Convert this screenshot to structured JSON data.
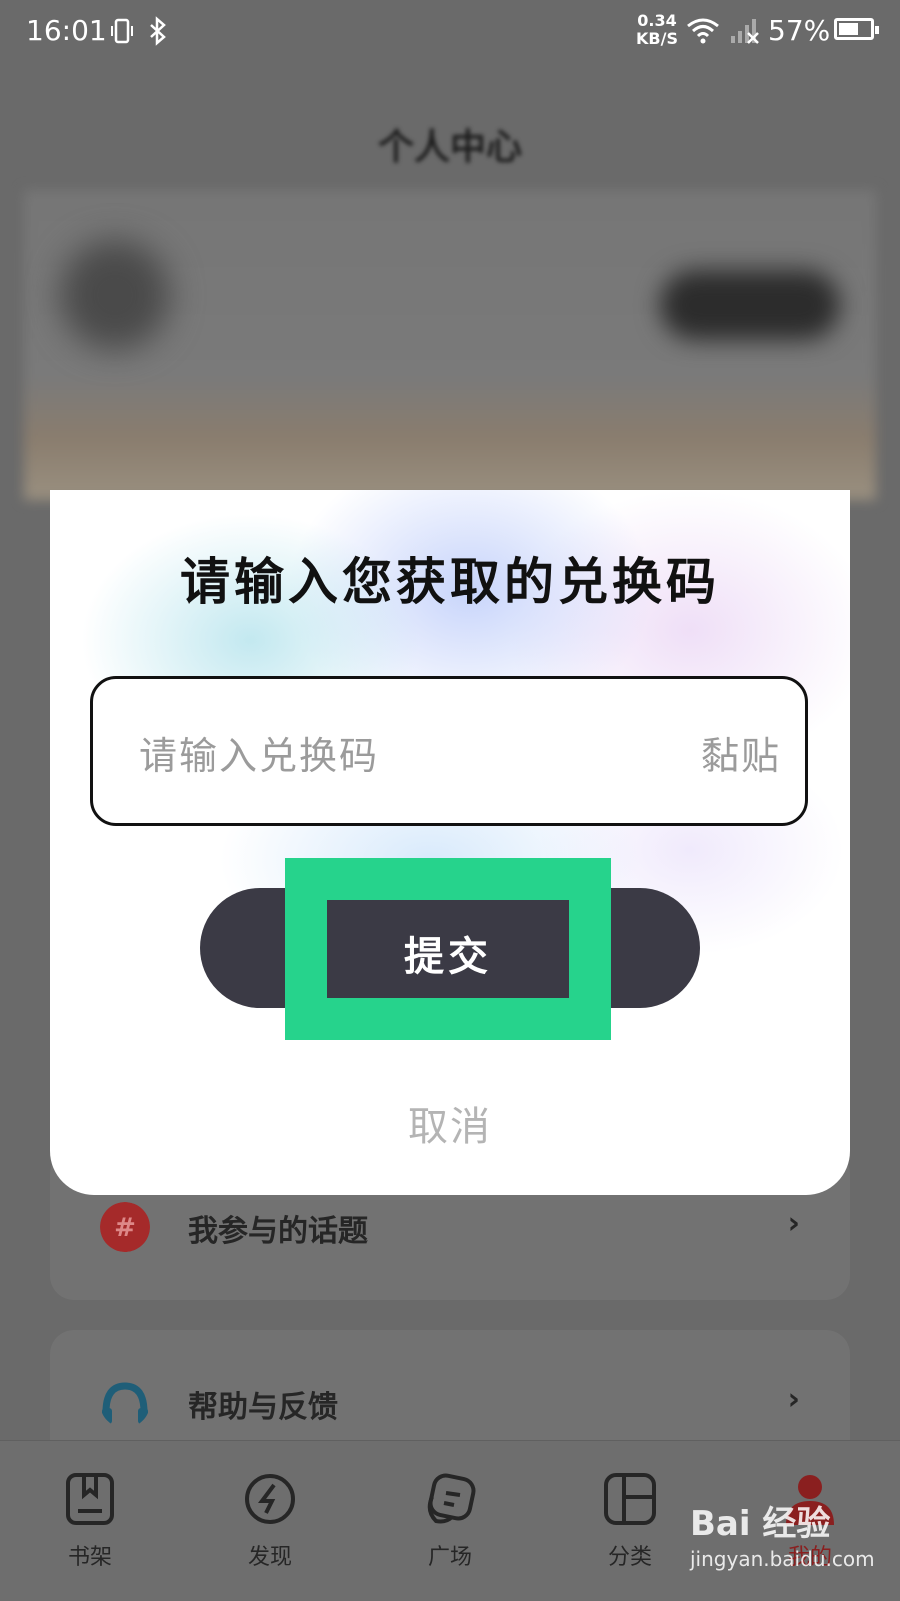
{
  "status_bar": {
    "time": "16:01",
    "net_speed_value": "0.34",
    "net_speed_unit": "KB/S",
    "battery_percent": "57%"
  },
  "background": {
    "page_title": "个人中心",
    "rows": [
      {
        "label": "我参与的话题",
        "icon": "hashtag-icon",
        "icon_color": "#b22a2a"
      },
      {
        "label": "帮助与反馈",
        "icon": "headset-icon",
        "icon_color": "#1f5e78"
      }
    ],
    "tabs": [
      {
        "label": "书架",
        "icon": "bookshelf-icon"
      },
      {
        "label": "发现",
        "icon": "compass-icon"
      },
      {
        "label": "广场",
        "icon": "chat-square-icon"
      },
      {
        "label": "分类",
        "icon": "category-grid-icon"
      },
      {
        "label": "我的",
        "icon": "profile-icon",
        "active_color": "#8a1f1f"
      }
    ]
  },
  "dialog": {
    "title": "请输入您获取的兑换码",
    "input_placeholder": "请输入兑换码",
    "paste_label": "黏贴",
    "submit_label": "提交",
    "cancel_label": "取消"
  },
  "watermark": {
    "text": "Bai 经验",
    "sub": "jingyan.baidu.com"
  },
  "colors": {
    "highlight": "#26d38c",
    "button": "#3b3a45"
  }
}
